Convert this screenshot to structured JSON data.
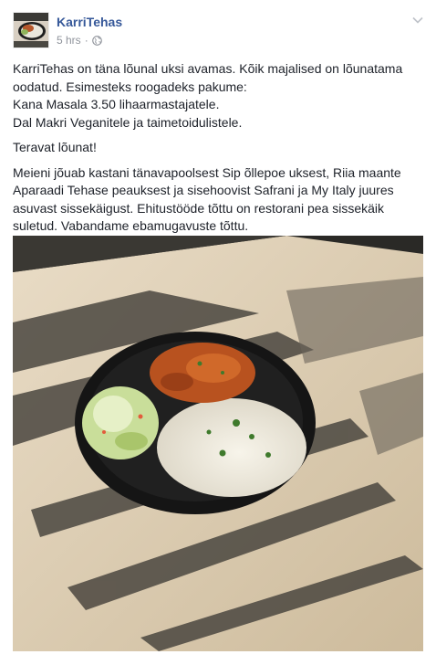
{
  "post": {
    "author": "KarriTehas",
    "time": "5 hrs",
    "separator": "·",
    "audience_icon": "globe-icon",
    "menu_icon": "chevron-down-icon",
    "paragraphs": [
      "KarriTehas on täna lõunal uksi avamas. Kõik majalised on lõunatama oodatud. Esimesteks roogadeks pakume:\nKana Masala 3.50 lihaarmastajatele.\nDal Makri Veganitele ja taimetoidulistele.",
      "Teravat lõunat!",
      "Meieni jõuab kastani tänavapoolsest Sip õllepoe uksest, Riia maante Aparaadi Tehase peauksest ja sisehoovist Safrani ja My Italy juures asuvast sissekäigust. Ehitustööde tõttu on restorani pea sissekäik suletud. Vabandame ebamugavuste tõttu."
    ]
  },
  "colors": {
    "author_link": "#365899",
    "meta_text": "#90949c",
    "body_text": "#1d2129"
  }
}
